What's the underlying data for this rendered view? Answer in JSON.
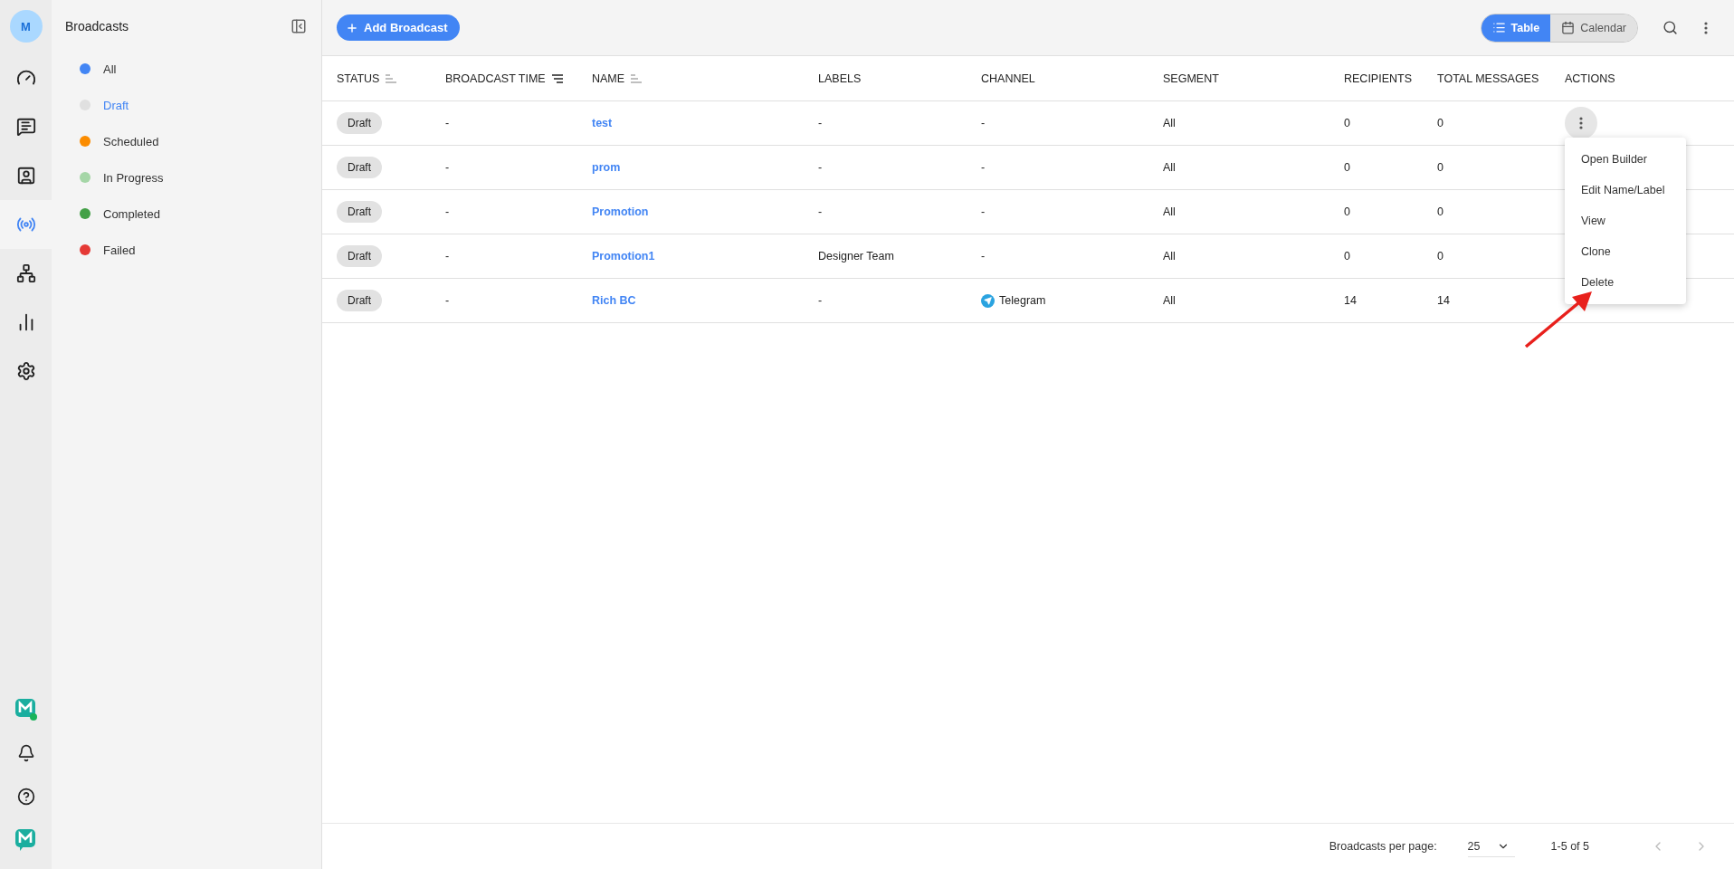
{
  "rail": {
    "avatar": "M",
    "items": [
      {
        "kind": "dashboard",
        "selected": false
      },
      {
        "kind": "chat",
        "selected": false
      },
      {
        "kind": "contacts",
        "selected": false
      },
      {
        "kind": "broadcast",
        "selected": true
      },
      {
        "kind": "flows",
        "selected": false
      },
      {
        "kind": "analytics",
        "selected": false
      },
      {
        "kind": "settings",
        "selected": false
      }
    ],
    "bottom": [
      {
        "kind": "status-logo"
      },
      {
        "kind": "notifications"
      },
      {
        "kind": "help"
      },
      {
        "kind": "logo"
      }
    ]
  },
  "sidebar": {
    "title": "Broadcasts",
    "items": [
      {
        "label": "All",
        "color": "#4285f4",
        "selected": false
      },
      {
        "label": "Draft",
        "color": "#e0e0e0",
        "selected": true
      },
      {
        "label": "Scheduled",
        "color": "#fb8c00",
        "selected": false
      },
      {
        "label": "In Progress",
        "color": "#a5d6a7",
        "selected": false
      },
      {
        "label": "Completed",
        "color": "#43a047",
        "selected": false
      },
      {
        "label": "Failed",
        "color": "#e53935",
        "selected": false
      }
    ]
  },
  "toolbar": {
    "add_button": "Add Broadcast",
    "views": [
      {
        "label": "Table",
        "kind": "table",
        "selected": true
      },
      {
        "label": "Calendar",
        "kind": "calendar",
        "selected": false
      }
    ]
  },
  "table": {
    "columns": [
      {
        "label": "STATUS",
        "sortable": true,
        "sort_active": false
      },
      {
        "label": "BROADCAST TIME",
        "sortable": true,
        "sort_active": true
      },
      {
        "label": "NAME",
        "sortable": true,
        "sort_active": false
      },
      {
        "label": "LABELS"
      },
      {
        "label": "CHANNEL"
      },
      {
        "label": "SEGMENT"
      },
      {
        "label": "RECIPIENTS"
      },
      {
        "label": "TOTAL MESSAGES"
      },
      {
        "label": "ACTIONS"
      }
    ],
    "rows": [
      {
        "status": "Draft",
        "time": "-",
        "name": "test",
        "labels": "-",
        "channel": {
          "text": "-",
          "kind": "none"
        },
        "segment": "All",
        "recipients": "0",
        "total": "0",
        "menu_open": true
      },
      {
        "status": "Draft",
        "time": "-",
        "name": "prom",
        "labels": "-",
        "channel": {
          "text": "-",
          "kind": "none"
        },
        "segment": "All",
        "recipients": "0",
        "total": "0",
        "menu_open": false
      },
      {
        "status": "Draft",
        "time": "-",
        "name": "Promotion",
        "labels": "-",
        "channel": {
          "text": "-",
          "kind": "none"
        },
        "segment": "All",
        "recipients": "0",
        "total": "0",
        "menu_open": false
      },
      {
        "status": "Draft",
        "time": "-",
        "name": "Promotion1",
        "labels": "Designer Team",
        "channel": {
          "text": "-",
          "kind": "none"
        },
        "segment": "All",
        "recipients": "0",
        "total": "0",
        "menu_open": false
      },
      {
        "status": "Draft",
        "time": "-",
        "name": "Rich BC",
        "labels": "-",
        "channel": {
          "text": "Telegram",
          "kind": "telegram"
        },
        "segment": "All",
        "recipients": "14",
        "total": "14",
        "menu_open": false
      }
    ]
  },
  "action_menu": [
    "Open Builder",
    "Edit Name/Label",
    "View",
    "Clone",
    "Delete"
  ],
  "pagination": {
    "label": "Broadcasts per page:",
    "per_page": "25",
    "range": "1-5 of 5",
    "prev_disabled": true,
    "next_disabled": true
  }
}
